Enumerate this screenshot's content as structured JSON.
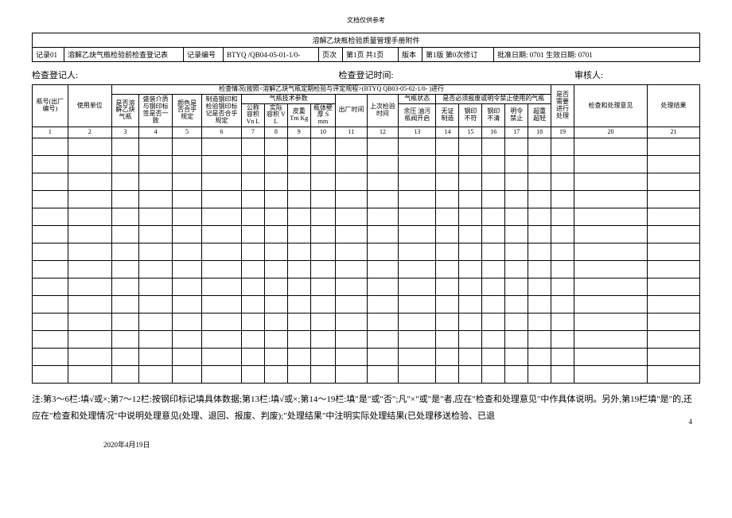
{
  "topNote": "文档仅供参考",
  "headerTable": {
    "title": "溶解乙炔瓶检验质量管理手册附件",
    "row2": {
      "c1": "记录01",
      "c2": "溶解乙炔气瓶检验前检查登记表",
      "c3": "记录编号",
      "c4": "BTYQ /QB04-05-01-1/0-",
      "c5": "页次",
      "c6": "第1页 共1页",
      "c7": "版本",
      "c8": "第1版 第0次修订",
      "c9": "批准日期: 0701  生效日期: 0701"
    }
  },
  "metaRow": {
    "left": "检查登记人:",
    "center": "检查登记时间:",
    "right": "审核人:"
  },
  "mainTable": {
    "checkTitle": "检查情况(按照<溶解乙炔气瓶定期检验与评定规程>(BTYQ QB03-05-02-1/0- )进行",
    "headers": {
      "bottleNo": "瓶号(出厂编号)",
      "user": "使用单位",
      "isAcet": "是否溶解乙炔气瓶",
      "fillMatch": "盛装介质与钢印标签是否一致",
      "colorOk": "颜色是否合乎规定",
      "stampOk": "制造钢印和检验钢印标记是否合乎规定",
      "techGroup": "气瓶技术参数",
      "nomVol": "公称容积 Vn L",
      "actVol": "实际容积 V L",
      "tare": "皮重 Tm Kg",
      "wall": "瓶体壁厚 S mm",
      "mfgDate": "出厂时间",
      "lastInsp": "上次检验时间",
      "stateGroup": "气瓶状态",
      "residual": "余压 油污 瓶阀开启",
      "scrapGroup": "是否必须报废或明令禁止使用的气瓶",
      "noCert": "无证制造",
      "stampBad": "钢印不符",
      "stampUnclear": "钢印不清",
      "banned": "明令禁止",
      "overlight": "超重超轻",
      "needFill": "是否需要进行处理",
      "opinion": "检查和处理意见",
      "result": "处理结果"
    },
    "colNums": [
      "1",
      "2",
      "3",
      "4",
      "5",
      "6",
      "7",
      "8",
      "9",
      "10",
      "11",
      "12",
      "13",
      "14",
      "15",
      "16",
      "17",
      "18",
      "19",
      "20",
      "21"
    ]
  },
  "footnote": "注:第3～6栏:填√或×;第7～12栏:按钢印标记填具体数据;第13栏:填√或×;第14～19栏:填\"是\"或\"否\";凡\"×\"或\"是\"者,应在\"检查和处理意见\"中作具体说明。另外,第19栏填\"是\"的,还应在\"检查和处理情况\"中说明处理意见(处理、退回、报废、判废);\"处理结果\"中注明实际处理结果(已处理移送检验、已退",
  "footerDate": "2020年4月19日",
  "pageNum": "4"
}
